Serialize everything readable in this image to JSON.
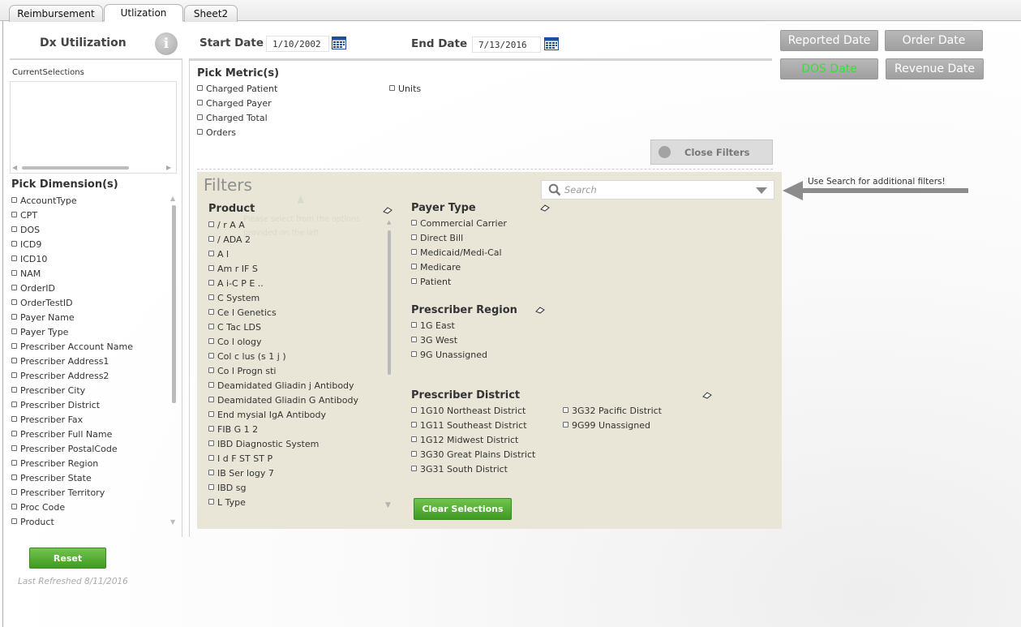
{
  "tabs": [
    {
      "label": "Reimbursement",
      "active": false
    },
    {
      "label": "Utlization",
      "active": true
    },
    {
      "label": "Sheet2",
      "active": false
    }
  ],
  "left": {
    "title": "Dx Utilization",
    "info_icon": "info-icon",
    "current_selections_label": "CurrentSelections",
    "pick_dimensions_label": "Pick Dimension(s)",
    "dimensions": [
      "AccountType",
      "CPT",
      "DOS",
      "ICD9",
      "ICD10",
      "NAM",
      "OrderID",
      "OrderTestID",
      "Payer Name",
      "Payer Type",
      "Prescriber Account Name",
      "Prescriber Address1",
      "Prescriber Address2",
      "Prescriber City",
      "Prescriber District",
      "Prescriber Fax",
      "Prescriber Full Name",
      "Prescriber PostalCode",
      "Prescriber Region",
      "Prescriber State",
      "Prescriber Territory",
      "Proc Code",
      "Product"
    ],
    "reset_label": "Reset",
    "last_refreshed": "Last Refreshed 8/11/2016"
  },
  "dates": {
    "start_label": "Start Date",
    "start_value": "1/10/2002",
    "end_label": "End Date",
    "end_value": "7/13/2016",
    "calendar_icon": "calendar-icon"
  },
  "date_buttons": {
    "reported": "Reported Date",
    "order": "Order Date",
    "dos": "DOS Date",
    "revenue": "Revenue Date",
    "dos_text_color": "#3ddc3d"
  },
  "metrics": {
    "title": "Pick Metric(s)",
    "col1": [
      "Charged Patient",
      "Charged Payer",
      "Charged Total",
      "Orders"
    ],
    "col2": [
      "Units"
    ]
  },
  "close_filters_label": "Close Filters",
  "filters": {
    "title": "Filters",
    "search_placeholder": "Search",
    "hint": "Use Search for additional filters!",
    "product": {
      "title": "Product",
      "items": [
        "/ r A  A",
        "/ ADA  2",
        "A   l",
        "Am r IF  S",
        "A i-C P E ..",
        "C  System",
        "Ce  l  Genetics",
        "C  Tac  LDS",
        "Co  l  ology",
        "Col c  lus (s  1  j  )",
        "Co  l  Progn  sti",
        "Deamidated Gliadin  j  Antibody",
        "Deamidated Gliadin  G Antibody",
        "End  mysial IgA Antibody",
        "FIB  G  1  2",
        "IBD Diagnostic System",
        "I  d  F  ST  ST  P",
        "IB  Ser  logy 7",
        "IBD sg",
        "L  Type"
      ],
      "ghost_hint": "Please select from the options provided on the left"
    },
    "payer_type": {
      "title": "Payer Type",
      "items": [
        "Commercial Carrier",
        "Direct Bill",
        "Medicaid/Medi-Cal",
        "Medicare",
        "Patient"
      ]
    },
    "prescriber_region": {
      "title": "Prescriber Region",
      "items": [
        "1G East",
        "3G West",
        "9G Unassigned"
      ]
    },
    "prescriber_district": {
      "title": "Prescriber District",
      "col1": [
        "1G10 Northeast District",
        "1G11 Southeast District",
        "1G12 Midwest District",
        "3G30 Great Plains District",
        "3G31 South District"
      ],
      "col2": [
        "3G32 Pacific District",
        "9G99 Unassigned"
      ]
    },
    "clear_label": "Clear Selections"
  },
  "colors": {
    "green": "#4ea82e",
    "panel": "#e9e6d7",
    "button_grey": "#a9a9a9"
  }
}
